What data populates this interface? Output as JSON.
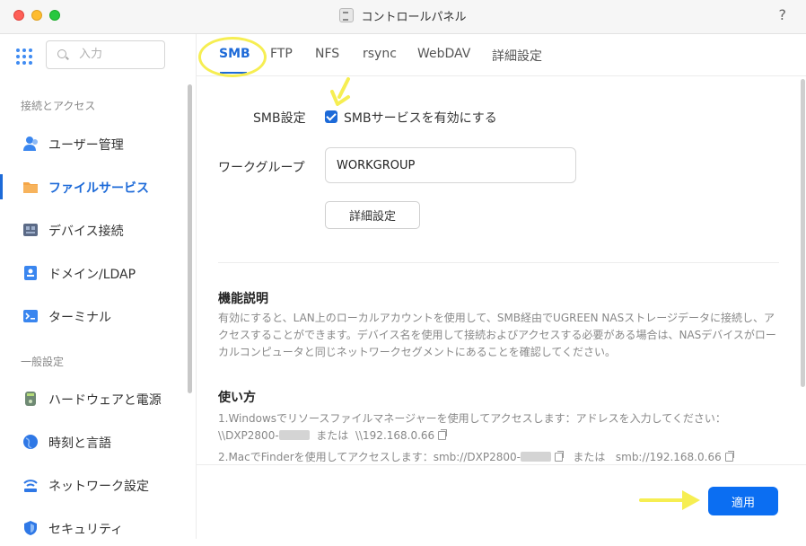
{
  "window": {
    "title": "コントロールパネル",
    "help": "?"
  },
  "sidebar": {
    "search_placeholder": "入力",
    "section1": "接続とアクセス",
    "section2": "一般設定",
    "items": [
      {
        "label": "ユーザー管理",
        "icon": "users-icon"
      },
      {
        "label": "ファイルサービス",
        "icon": "folder-icon"
      },
      {
        "label": "デバイス接続",
        "icon": "device-icon"
      },
      {
        "label": "ドメイン/LDAP",
        "icon": "domain-icon"
      },
      {
        "label": "ターミナル",
        "icon": "terminal-icon"
      },
      {
        "label": "ハードウェアと電源",
        "icon": "hardware-icon"
      },
      {
        "label": "時刻と言語",
        "icon": "globe-icon"
      },
      {
        "label": "ネットワーク設定",
        "icon": "network-icon"
      },
      {
        "label": "セキュリティ",
        "icon": "shield-icon"
      }
    ]
  },
  "tabs": [
    "SMB",
    "FTP",
    "NFS",
    "rsync",
    "WebDAV",
    "詳細設定"
  ],
  "smb": {
    "setting_label": "SMB設定",
    "enable_label": "SMBサービスを有効にする",
    "enabled": true,
    "workgroup_label": "ワークグループ",
    "workgroup_value": "WORKGROUP",
    "advanced_button": "詳細設定"
  },
  "description": {
    "title": "機能説明",
    "text": "有効にすると、LAN上のローカルアカウントを使用して、SMB経由でUGREEN NASストレージデータに接続し、アクセスすることができます。デバイス名を使用して接続およびアクセスする必要がある場合は、NASデバイスがローカルコンピュータと同じネットワークセグメントにあることを確認してください。"
  },
  "usage": {
    "title": "使い方",
    "line1": "1.Windowsでリソースファイルマネージャーを使用してアクセスします：アドレスを入力してください：",
    "line2_prefix": "\\\\DXP2800-",
    "line2_or": "または",
    "line2_ip": "\\\\192.168.0.66",
    "line3_prefix": "2.MacでFinderを使用してアクセスします：smb://DXP2800-",
    "line3_or": "または",
    "line3_ip": "smb://192.168.0.66"
  },
  "footer": {
    "apply": "適用"
  },
  "colors": {
    "accent": "#1d6ad8",
    "apply": "#0b6ef2",
    "highlight": "#f6ee52"
  }
}
